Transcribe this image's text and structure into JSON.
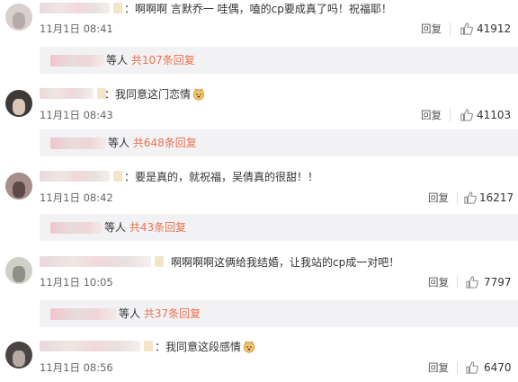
{
  "comments": [
    {
      "text": "：啊啊啊 言默乔一 哇偶，嗑的cp要成真了吗！祝福耶！",
      "emoji": "",
      "date": "11月1日 08:41",
      "reply_label": "回复",
      "likes": "41912",
      "sub_deng": "等人",
      "sub_count": "共107条回复"
    },
    {
      "text": "：我同意这门恋情",
      "emoji": "doge-emoji",
      "date": "11月1日 08:43",
      "reply_label": "回复",
      "likes": "41103",
      "sub_deng": "等人",
      "sub_count": "共648条回复"
    },
    {
      "text": "：要是真的，就祝福，吴倩真的很甜！！",
      "emoji": "",
      "date": "11月1日 08:42",
      "reply_label": "回复",
      "likes": "16217",
      "sub_deng": "等人",
      "sub_count": "共43条回复"
    },
    {
      "text": "啊啊啊啊这俩给我结婚，让我站的cp成一对吧！",
      "emoji": "",
      "date": "11月1日 10:05",
      "reply_label": "回复",
      "likes": "7797",
      "sub_deng": "等人",
      "sub_count": "共37条回复"
    },
    {
      "text": "：我同意这段感情",
      "emoji": "doge-emoji",
      "date": "11月1日 08:56",
      "reply_label": "回复",
      "likes": "6470",
      "sub_deng": "",
      "sub_count": ""
    }
  ],
  "icons": {
    "like": "thumbs-up-icon",
    "avatar": "user-avatar"
  },
  "colors": {
    "link": "#eb7350",
    "sub_bg": "#f2f2f5",
    "text": "#333333",
    "muted": "#666666"
  }
}
